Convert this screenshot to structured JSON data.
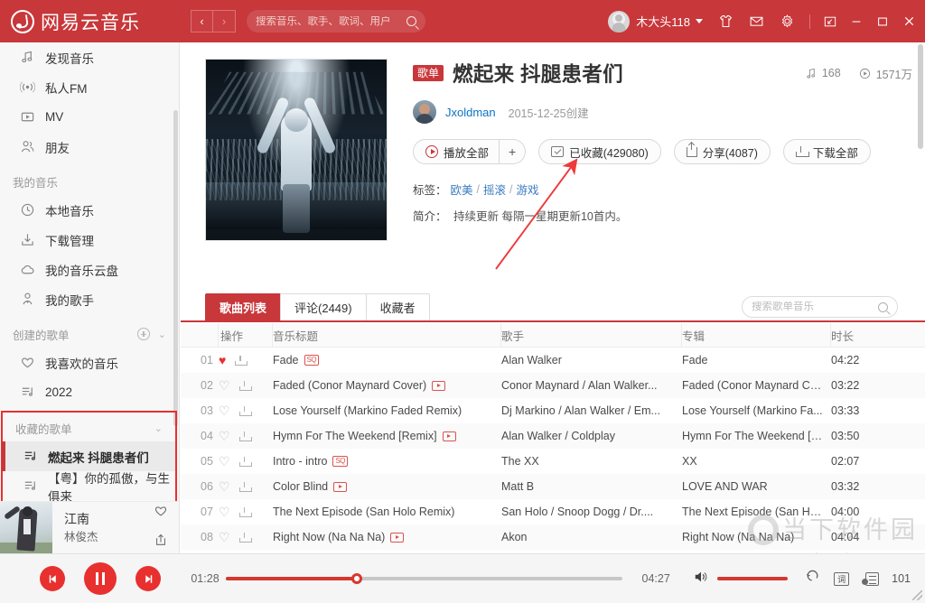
{
  "app": {
    "brand": "网易云音乐",
    "nav_back": "‹",
    "nav_forward": "›",
    "search_placeholder": "搜索音乐、歌手、歌词、用户",
    "search_value": "",
    "username": "木大头118",
    "accent_color": "#c8373a",
    "header_bg": "#c8373a"
  },
  "sidebar": {
    "top_items": [
      {
        "label": "发现音乐",
        "icon": "music-note-icon"
      },
      {
        "label": "私人FM",
        "icon": "radio-icon"
      },
      {
        "label": "MV",
        "icon": "video-icon"
      },
      {
        "label": "朋友",
        "icon": "friends-icon"
      }
    ],
    "my_music_header": "我的音乐",
    "my_music_items": [
      {
        "label": "本地音乐",
        "icon": "clock-icon"
      },
      {
        "label": "下载管理",
        "icon": "download-icon"
      },
      {
        "label": "我的音乐云盘",
        "icon": "cloud-icon"
      },
      {
        "label": "我的歌手",
        "icon": "singer-icon"
      }
    ],
    "created_header": "创建的歌单",
    "created_items": [
      {
        "label": "我喜欢的音乐",
        "icon": "heart-icon"
      },
      {
        "label": "2022",
        "icon": "playlist-icon"
      }
    ],
    "collected_header": "收藏的歌单",
    "collected_items": [
      {
        "label": "燃起来 抖腿患者们",
        "icon": "playlist-icon",
        "selected": true
      },
      {
        "label": "【粤】你的孤傲，与生俱来",
        "icon": "playlist-icon",
        "selected": false
      }
    ],
    "now_playing": {
      "title": "江南",
      "artist": "林俊杰"
    }
  },
  "playlist": {
    "badge": "歌单",
    "title": "燃起来 抖腿患者们",
    "song_count": "168",
    "play_count": "1571万",
    "author": "Jxoldman",
    "created_date": "2015-12-25创建",
    "buttons": {
      "play_all": "播放全部",
      "add": "+",
      "favorite": "已收藏(429080)",
      "share": "分享(4087)",
      "download_all": "下载全部"
    },
    "tags_label": "标签：",
    "tags": [
      "欧美",
      "摇滚",
      "游戏"
    ],
    "desc_label": "简介：",
    "desc": "持续更新 每隔一星期更新10首内。"
  },
  "tabs": {
    "items": [
      {
        "label": "歌曲列表",
        "active": true
      },
      {
        "label": "评论(2449)",
        "active": false
      },
      {
        "label": "收藏者",
        "active": false
      }
    ],
    "search_placeholder": "搜索歌单音乐",
    "search_value": ""
  },
  "table": {
    "headers": [
      "",
      "操作",
      "音乐标题",
      "歌手",
      "专辑",
      "时长"
    ],
    "rows": [
      {
        "num": "01",
        "liked": true,
        "title": "Fade",
        "badge": "sq",
        "artist": "Alan Walker",
        "album": "Fade",
        "length": "04:22"
      },
      {
        "num": "02",
        "liked": false,
        "title": "Faded (Conor Maynard Cover)",
        "badge": "mv",
        "artist": "Conor Maynard / Alan Walker...",
        "album": "Faded (Conor Maynard Co...",
        "length": "03:22"
      },
      {
        "num": "03",
        "liked": false,
        "title": "Lose Yourself (Markino Faded Remix)",
        "badge": "",
        "artist": "Dj Markino / Alan Walker / Em...",
        "album": "Lose Yourself (Markino Fa...",
        "length": "03:33"
      },
      {
        "num": "04",
        "liked": false,
        "title": "Hymn For The Weekend [Remix]",
        "badge": "mv",
        "artist": "Alan Walker / Coldplay",
        "album": "Hymn For The Weekend [R...",
        "length": "03:50"
      },
      {
        "num": "05",
        "liked": false,
        "title": "Intro - intro",
        "badge": "sq",
        "artist": "The XX",
        "album": "XX",
        "length": "02:07"
      },
      {
        "num": "06",
        "liked": false,
        "title": "Color Blind",
        "badge": "mv",
        "artist": "Matt B",
        "album": "LOVE AND WAR",
        "length": "03:32"
      },
      {
        "num": "07",
        "liked": false,
        "title": "The Next Episode (San Holo Remix)",
        "badge": "",
        "artist": "San Holo / Snoop Dogg / Dr....",
        "album": "The Next Episode (San Ho...",
        "length": "04:00"
      },
      {
        "num": "08",
        "liked": false,
        "title": "Right Now (Na Na Na)",
        "badge": "mv",
        "artist": "Akon",
        "album": "Right Now (Na Na Na)",
        "length": "04:04"
      }
    ]
  },
  "player": {
    "current_time": "01:28",
    "total_time": "04:27",
    "progress_percent": 33,
    "playlist_count": "101",
    "lyric_toggle": "词"
  },
  "watermark": {
    "main": "当下软件园",
    "sub": "www.downxia.com"
  }
}
